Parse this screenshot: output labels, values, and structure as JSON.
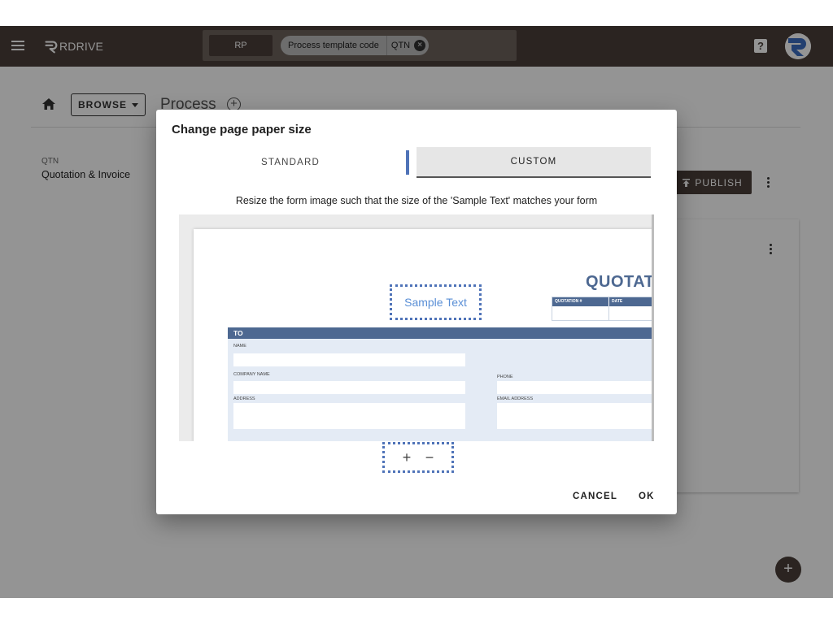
{
  "appbar": {
    "logo_text": "RDRIVE",
    "filter": {
      "rp_label": "RP",
      "chip_label": "Process template code",
      "chip_value": "QTN"
    },
    "help_label": "?"
  },
  "page": {
    "browse_label": "BROWSE",
    "title": "Process",
    "template": {
      "code": "QTN",
      "name": "Quotation & Invoice"
    },
    "publish_label": "PUBLISH"
  },
  "dialog": {
    "title": "Change page paper size",
    "tabs": {
      "standard": "STANDARD",
      "custom": "CUSTOM"
    },
    "instructions": "Resize the form image such that the size of the 'Sample Text' matches your form",
    "sample_text": "Sample Text",
    "zoom_in": "+",
    "zoom_out": "−",
    "cancel_label": "CANCEL",
    "ok_label": "OK"
  },
  "form_preview": {
    "doc_title": "QUOTATION",
    "quotation_header": "QUOTATION #",
    "date_header": "DATE",
    "to_header": "TO",
    "name_label": "NAME",
    "company_label": "COMPANY NAME",
    "phone_label": "PHONE",
    "address_label": "ADDRESS",
    "email_label": "EMAIL ADDRESS"
  },
  "colors": {
    "appbar": "#4a3f3a",
    "accent": "#4f73b8",
    "form_blue": "#4d6891"
  }
}
